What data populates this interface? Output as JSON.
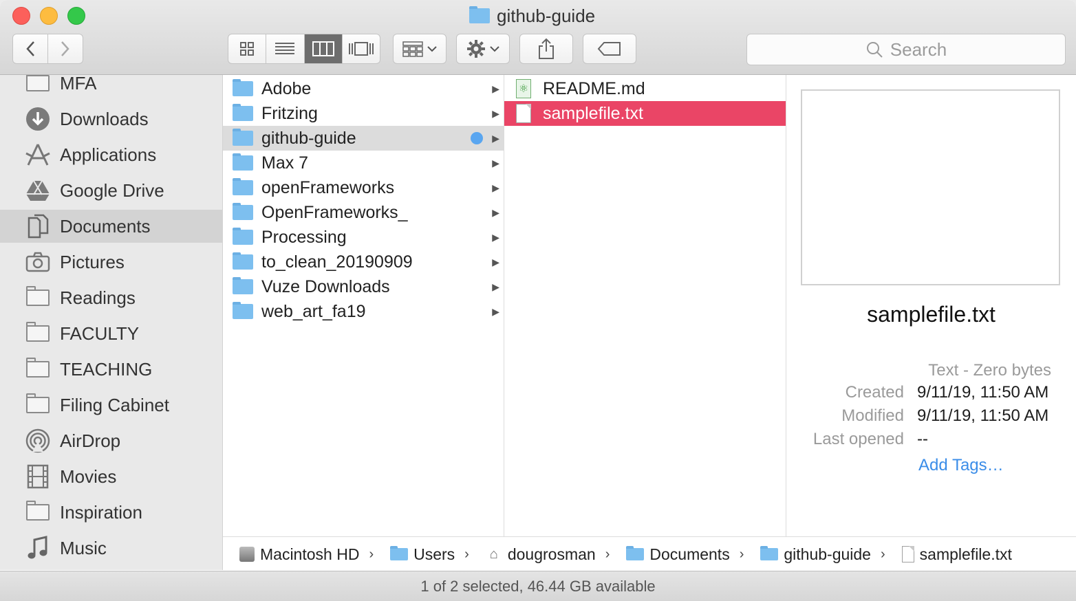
{
  "window": {
    "title": "github-guide"
  },
  "toolbar": {
    "search_placeholder": "Search"
  },
  "sidebar": {
    "items": [
      {
        "label": "MFA",
        "icon": "folder-icon"
      },
      {
        "label": "Downloads",
        "icon": "download-icon"
      },
      {
        "label": "Applications",
        "icon": "applications-icon"
      },
      {
        "label": "Google Drive",
        "icon": "google-drive-icon"
      },
      {
        "label": "Documents",
        "icon": "documents-icon",
        "selected": true
      },
      {
        "label": "Pictures",
        "icon": "camera-icon"
      },
      {
        "label": "Readings",
        "icon": "folder-icon"
      },
      {
        "label": "FACULTY",
        "icon": "folder-icon"
      },
      {
        "label": "TEACHING",
        "icon": "folder-icon"
      },
      {
        "label": "Filing Cabinet",
        "icon": "folder-icon"
      },
      {
        "label": "AirDrop",
        "icon": "airdrop-icon"
      },
      {
        "label": "Movies",
        "icon": "film-icon"
      },
      {
        "label": "Inspiration",
        "icon": "folder-icon"
      },
      {
        "label": "Music",
        "icon": "music-note-icon"
      }
    ]
  },
  "column1": {
    "items": [
      {
        "label": "Adobe"
      },
      {
        "label": "Fritzing"
      },
      {
        "label": "github-guide",
        "focused": true,
        "tag_color": "#5aa6f0"
      },
      {
        "label": "Max 7"
      },
      {
        "label": "openFrameworks"
      },
      {
        "label": "OpenFrameworks_"
      },
      {
        "label": "Processing"
      },
      {
        "label": "to_clean_20190909"
      },
      {
        "label": "Vuze Downloads"
      },
      {
        "label": "web_art_fa19"
      }
    ]
  },
  "column2": {
    "items": [
      {
        "label": "README.md",
        "icon": "markdown-file-icon"
      },
      {
        "label": "samplefile.txt",
        "icon": "text-file-icon",
        "selected": true
      }
    ]
  },
  "preview": {
    "filename": "samplefile.txt",
    "kind": "Text - Zero bytes",
    "created_label": "Created",
    "created_value": "9/11/19, 11:50 AM",
    "modified_label": "Modified",
    "modified_value": "9/11/19, 11:50 AM",
    "last_opened_label": "Last opened",
    "last_opened_value": "--",
    "add_tags": "Add Tags…"
  },
  "pathbar": {
    "crumbs": [
      {
        "label": "Macintosh HD",
        "icon": "hard-drive-icon"
      },
      {
        "label": "Users",
        "icon": "folder-icon"
      },
      {
        "label": "dougrosman",
        "icon": "home-icon"
      },
      {
        "label": "Documents",
        "icon": "folder-icon"
      },
      {
        "label": "github-guide",
        "icon": "folder-icon"
      },
      {
        "label": "samplefile.txt",
        "icon": "text-file-icon"
      }
    ]
  },
  "status": {
    "text": "1 of 2 selected, 46.44 GB available"
  },
  "colors": {
    "selection": "#ea4566",
    "accent": "#3b8de8",
    "folder": "#7dbfef"
  }
}
